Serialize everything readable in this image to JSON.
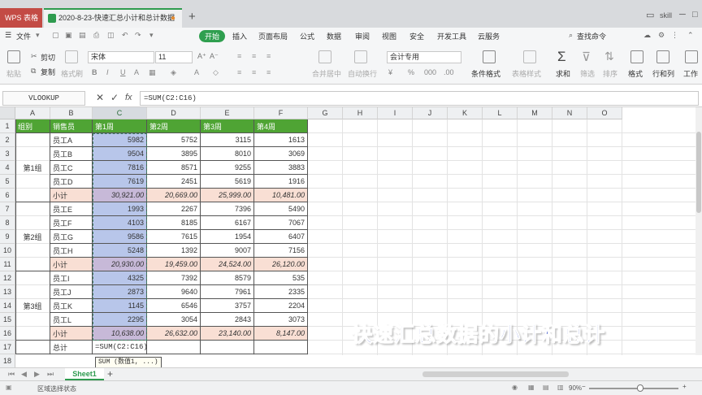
{
  "titlebar": {
    "app_tab": "WPS 表格",
    "doc_tab": "2020-8-23-快速汇总小计和总计数据",
    "modified_dot": "●",
    "new_tab": "+",
    "user": "skill"
  },
  "menu": {
    "file": "文件",
    "tabs": [
      "开始",
      "插入",
      "页面布局",
      "公式",
      "数据",
      "审阅",
      "视图",
      "安全",
      "开发工具",
      "云服务"
    ],
    "search": "查找命令"
  },
  "ribbon": {
    "paste": "粘贴",
    "cut": "剪切",
    "copy": "复制",
    "format_painter": "格式刷",
    "font_name": "宋体",
    "font_size": "11",
    "merge": "合并居中",
    "wrap": "自动换行",
    "num_format": "会计专用",
    "conditional": "条件格式",
    "table_style": "表格样式",
    "sum": "求和",
    "filter": "筛选",
    "sort": "排序",
    "format": "格式",
    "rows_cols": "行和列",
    "worksheet": "工作"
  },
  "formula_bar": {
    "name_box": "VLOOKUP",
    "fx": "fx",
    "formula": "=SUM(C2:C16)"
  },
  "columns": [
    "A",
    "B",
    "C",
    "D",
    "E",
    "F",
    "G",
    "H",
    "I",
    "J",
    "K",
    "L",
    "M",
    "N",
    "O"
  ],
  "rows": [
    "1",
    "2",
    "3",
    "4",
    "5",
    "6",
    "7",
    "8",
    "9",
    "10",
    "11",
    "12",
    "13",
    "14",
    "15",
    "16",
    "17",
    "18"
  ],
  "table": {
    "headers": [
      "组别",
      "销售员",
      "第1周",
      "第2周",
      "第3周",
      "第4周"
    ],
    "groups": [
      "第1组",
      "第2组",
      "第3组"
    ],
    "rows": [
      [
        "员工A",
        "5982",
        "5752",
        "3115",
        "1613"
      ],
      [
        "员工B",
        "9504",
        "3895",
        "8010",
        "3069"
      ],
      [
        "员工C",
        "7816",
        "8571",
        "9255",
        "3883"
      ],
      [
        "员工D",
        "7619",
        "2451",
        "5619",
        "1916"
      ],
      [
        "小计",
        "30,921.00",
        "20,669.00",
        "25,999.00",
        "10,481.00"
      ],
      [
        "员工E",
        "1993",
        "2267",
        "7396",
        "5490"
      ],
      [
        "员工F",
        "4103",
        "8185",
        "6167",
        "7067"
      ],
      [
        "员工G",
        "9586",
        "7615",
        "1954",
        "6407"
      ],
      [
        "员工H",
        "5248",
        "1392",
        "9007",
        "7156"
      ],
      [
        "小计",
        "20,930.00",
        "19,459.00",
        "24,524.00",
        "26,120.00"
      ],
      [
        "员工I",
        "4325",
        "7392",
        "8579",
        "535"
      ],
      [
        "员工J",
        "2873",
        "9640",
        "7961",
        "2335"
      ],
      [
        "员工K",
        "1145",
        "6546",
        "3757",
        "2204"
      ],
      [
        "员工L",
        "2295",
        "3054",
        "2843",
        "3073"
      ],
      [
        "小计",
        "10,638.00",
        "26,632.00",
        "23,140.00",
        "8,147.00"
      ]
    ],
    "total_label": "总计",
    "total_formula": "=SUM(C2:C16)"
  },
  "tooltip": "SUM (数值1, ...)",
  "sheet_tab": "Sheet1",
  "status": {
    "mode": "区域选择状态",
    "zoom": "90%"
  },
  "overlay_caption": "快速汇总数据的小计和总计",
  "colors": {
    "header_green": "#4fa434",
    "subtotal_pink": "#f9dfd4",
    "selection_blue": "#b8c6ea",
    "accent_green": "#2e9b4f"
  }
}
